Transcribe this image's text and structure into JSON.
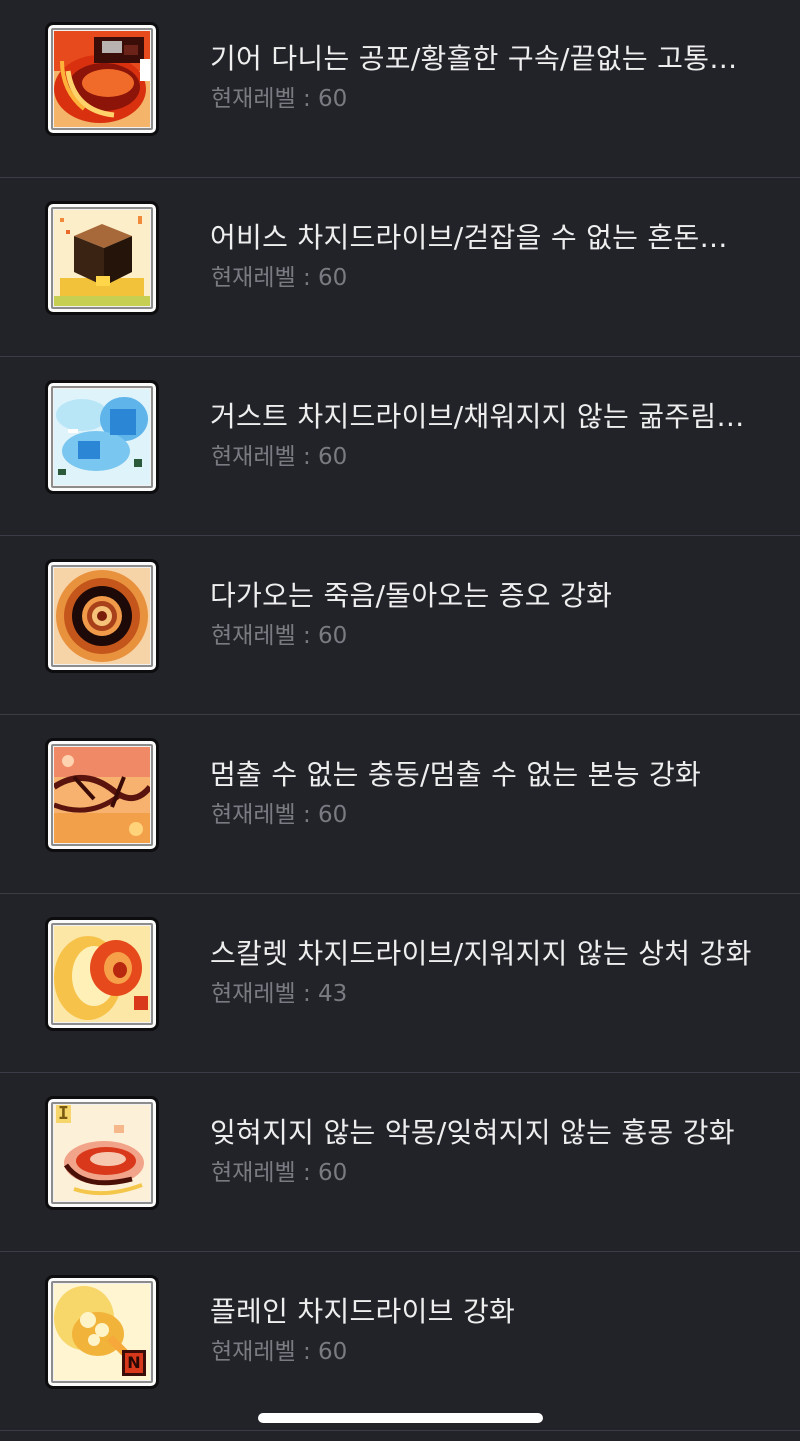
{
  "items": [
    {
      "title": "기어 다니는 공포/황홀한 구속/끝없는 고통…",
      "level": "현재레벨 : 60",
      "icon": "crawling-horror-skill-icon"
    },
    {
      "title": "어비스 차지드라이브/걷잡을 수 없는 혼돈…",
      "level": "현재레벨 : 60",
      "icon": "abyss-chargedrive-skill-icon"
    },
    {
      "title": "거스트 차지드라이브/채워지지 않는 굶주림…",
      "level": "현재레벨 : 60",
      "icon": "gust-chargedrive-skill-icon"
    },
    {
      "title": "다가오는 죽음/돌아오는 증오 강화",
      "level": "현재레벨 : 60",
      "icon": "approaching-death-skill-icon"
    },
    {
      "title": "멈출 수 없는 충동/멈출 수 없는 본능 강화",
      "level": "현재레벨 : 60",
      "icon": "unstoppable-impulse-skill-icon"
    },
    {
      "title": "스칼렛 차지드라이브/지워지지 않는 상처 강화",
      "level": "현재레벨 : 43",
      "icon": "scarlet-chargedrive-skill-icon"
    },
    {
      "title": "잊혀지지 않는 악몽/잊혀지지 않는 흉몽 강화",
      "level": "현재레벨 : 60",
      "icon": "unforgettable-nightmare-skill-icon"
    },
    {
      "title": "플레인 차지드라이브 강화",
      "level": "현재레벨 : 60",
      "icon": "plain-chargedrive-skill-icon",
      "badge": "N"
    }
  ],
  "icon_badge_roman": "I",
  "colors": {
    "background": "#222329",
    "divider": "#3b3d46",
    "title": "#eeeeee",
    "level": "#7a7b82"
  }
}
